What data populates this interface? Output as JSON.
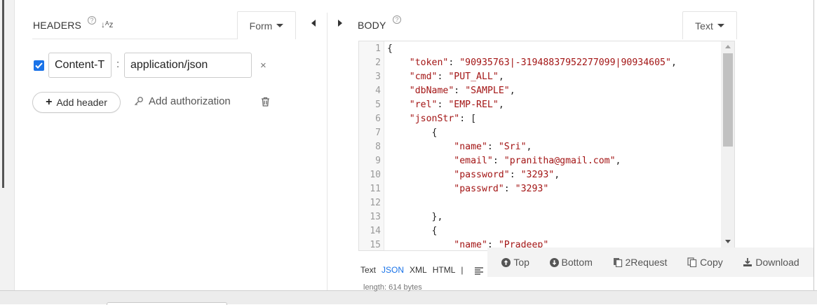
{
  "headers_panel": {
    "title": "HEADERS",
    "help_glyph": "?",
    "sort_glyph": "↓ᴬz",
    "mode": "Form",
    "header_rows": [
      {
        "enabled": true,
        "name": "Content-T",
        "value": "application/json"
      }
    ],
    "colon": ":",
    "remove_glyph": "×",
    "add_header_label": "Add header",
    "add_authorization_label": "Add authorization"
  },
  "body_panel": {
    "title": "BODY",
    "help_glyph": "?",
    "mode": "Text",
    "line_numbers": [
      "1",
      "2",
      "3",
      "4",
      "5",
      "6",
      "7",
      "8",
      "9",
      "10",
      "11",
      "12",
      "13",
      "14",
      "15"
    ],
    "code_lines": [
      "{",
      "    \"token\": \"90935763|-31948837952277099|90934605\",",
      "    \"cmd\": \"PUT_ALL\",",
      "    \"dbName\": \"SAMPLE\",",
      "    \"rel\": \"EMP-REL\",",
      "    \"jsonStr\": [",
      "        {",
      "            \"name\": \"Sri\",",
      "            \"email\": \"pranitha@gmail.com\",",
      "            \"password\": \"3293\",",
      "            \"passwrd\": \"3293\"",
      "",
      "        },",
      "        {",
      "            \"name\": \"Pradeep\""
    ],
    "formats": [
      "Text",
      "JSON",
      "XML",
      "HTML"
    ],
    "active_format": "JSON",
    "format_separator": "|",
    "length_text": "length: 614 bytes"
  },
  "toolbar": {
    "top": "Top",
    "bottom": "Bottom",
    "to_request": "2Request",
    "copy": "Copy",
    "download": "Download"
  },
  "colors": {
    "accent": "#1a73e8",
    "json_string": "#a31515"
  }
}
